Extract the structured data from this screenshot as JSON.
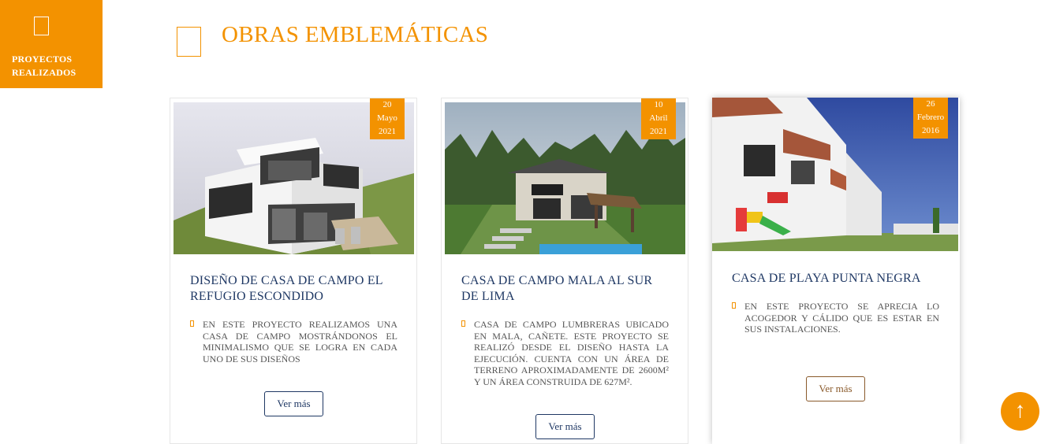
{
  "side_tab": {
    "label_line1": "PROYECTOS",
    "label_line2": "REALIZADOS",
    "icon": "square-outline-icon"
  },
  "heading": {
    "title": "OBRAS EMBLEMÁTICAS"
  },
  "colors": {
    "accent": "#f39200",
    "navy": "#1f3864"
  },
  "cards": [
    {
      "date": {
        "day": "20",
        "month": "Mayo",
        "year": "2021"
      },
      "title": "DISEÑO DE CASA DE CAMPO EL REFUGIO ESCONDIDO",
      "description": "EN ESTE PROYECTO REALIZAMOS UNA CASA DE CAMPO MOSTRÁNDONOS EL MINIMALISMO QUE SE LOGRA EN CADA UNO DE SUS DISEÑOS",
      "button": "Ver más"
    },
    {
      "date": {
        "day": "10",
        "month": "Abril",
        "year": "2021"
      },
      "title": "CASA DE CAMPO MALA AL SUR DE LIMA",
      "description": "CASA DE CAMPO LUMBRERAS UBICADO EN MALA, CAÑETE. ESTE PROYECTO SE REALIZÓ DESDE EL DISEÑO HASTA LA EJECUCIÓN. CUENTA CON UN ÁREA DE TERRENO APROXIMADAMENTE DE 2600M² Y UN ÁREA CONSTRUIDA DE 627M².",
      "button": "Ver más"
    },
    {
      "date": {
        "day": "26",
        "month": "Febrero",
        "year": "2016"
      },
      "title": "CASA DE PLAYA PUNTA NEGRA",
      "description": "EN ESTE PROYECTO SE APRECIA LO ACOGEDOR Y CÁLIDO QUE ES ESTAR EN SUS INSTALACIONES.",
      "button": "Ver más"
    }
  ],
  "scroll_top": {
    "icon": "arrow-up-icon",
    "glyph": "↑"
  }
}
